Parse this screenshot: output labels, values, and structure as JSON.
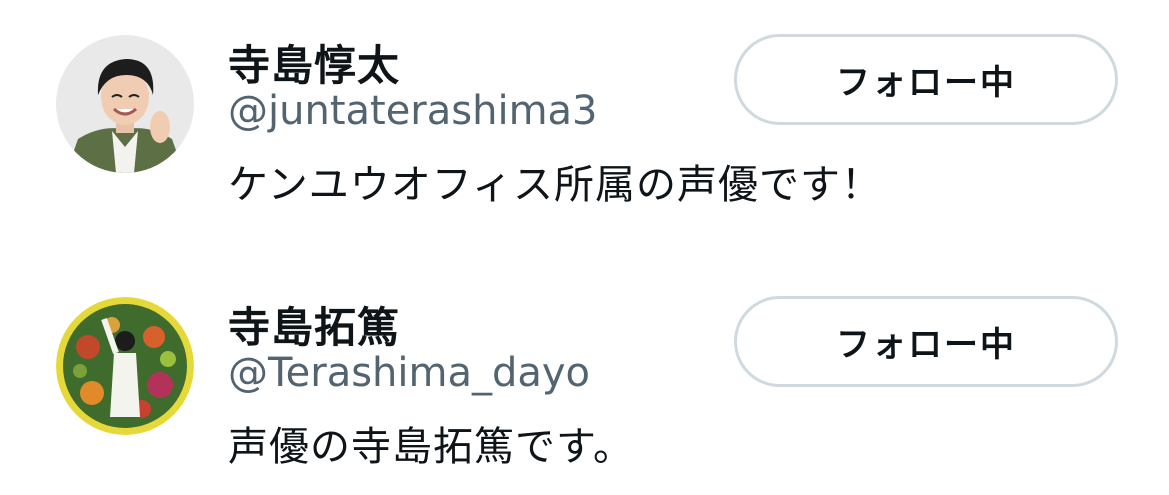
{
  "users": [
    {
      "display_name": "寺島惇太",
      "handle": "@juntaterashima3",
      "bio": "ケンユウオフィス所属の声優です！",
      "follow_button_label": "フォロー中"
    },
    {
      "display_name": "寺島拓篤",
      "handle": "@Terashima_dayo",
      "bio": "声優の寺島拓篤です。",
      "follow_button_label": "フォロー中"
    }
  ],
  "colors": {
    "text_primary": "#0f1419",
    "text_secondary": "#536471",
    "button_border": "#cfd9de",
    "avatar_ring_2": "#e5d93a"
  }
}
